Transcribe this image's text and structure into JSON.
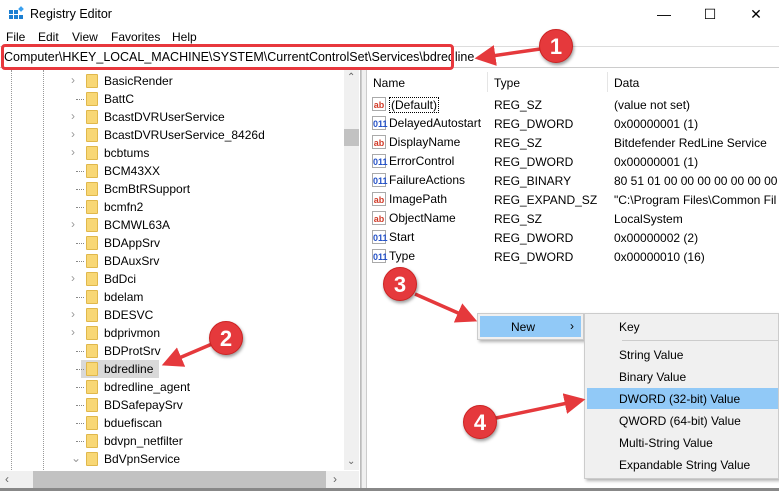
{
  "window": {
    "title": "Registry Editor",
    "controls": [
      "—",
      "☐",
      "✕"
    ]
  },
  "menu": [
    "File",
    "Edit",
    "View",
    "Favorites",
    "Help"
  ],
  "address": "Computer\\HKEY_LOCAL_MACHINE\\SYSTEM\\CurrentControlSet\\Services\\bdredline",
  "tree": {
    "items": [
      {
        "label": "BasicRender",
        "expander": "collapsed"
      },
      {
        "label": "BattC",
        "expander": "none"
      },
      {
        "label": "BcastDVRUserService",
        "expander": "collapsed"
      },
      {
        "label": "BcastDVRUserService_8426d",
        "expander": "collapsed"
      },
      {
        "label": "bcbtums",
        "expander": "collapsed"
      },
      {
        "label": "BCM43XX",
        "expander": "none"
      },
      {
        "label": "BcmBtRSupport",
        "expander": "none"
      },
      {
        "label": "bcmfn2",
        "expander": "none"
      },
      {
        "label": "BCMWL63A",
        "expander": "collapsed"
      },
      {
        "label": "BDAppSrv",
        "expander": "none"
      },
      {
        "label": "BDAuxSrv",
        "expander": "none"
      },
      {
        "label": "BdDci",
        "expander": "collapsed"
      },
      {
        "label": "bdelam",
        "expander": "none"
      },
      {
        "label": "BDESVC",
        "expander": "collapsed"
      },
      {
        "label": "bdprivmon",
        "expander": "collapsed"
      },
      {
        "label": "BDProtSrv",
        "expander": "none"
      },
      {
        "label": "bdredline",
        "expander": "none",
        "selected": true
      },
      {
        "label": "bdredline_agent",
        "expander": "none"
      },
      {
        "label": "BDSafepaySrv",
        "expander": "none"
      },
      {
        "label": "bduefiscan",
        "expander": "none"
      },
      {
        "label": "bdvpn_netfilter",
        "expander": "none"
      },
      {
        "label": "BdVpnService",
        "expander": "expanded"
      }
    ]
  },
  "list": {
    "columns": [
      "Name",
      "Type",
      "Data"
    ],
    "rows": [
      {
        "icon": "ab",
        "name": "(Default)",
        "type": "REG_SZ",
        "data": "(value not set)"
      },
      {
        "icon": "bin",
        "name": "DelayedAutostart",
        "type": "REG_DWORD",
        "data": "0x00000001 (1)"
      },
      {
        "icon": "ab",
        "name": "DisplayName",
        "type": "REG_SZ",
        "data": "Bitdefender RedLine Service"
      },
      {
        "icon": "bin",
        "name": "ErrorControl",
        "type": "REG_DWORD",
        "data": "0x00000001 (1)"
      },
      {
        "icon": "bin",
        "name": "FailureActions",
        "type": "REG_BINARY",
        "data": "80 51 01 00 00 00 00 00 00 00 00"
      },
      {
        "icon": "ab",
        "name": "ImagePath",
        "type": "REG_EXPAND_SZ",
        "data": "\"C:\\Program Files\\Common Fil"
      },
      {
        "icon": "ab",
        "name": "ObjectName",
        "type": "REG_SZ",
        "data": "LocalSystem"
      },
      {
        "icon": "bin",
        "name": "Start",
        "type": "REG_DWORD",
        "data": "0x00000002 (2)"
      },
      {
        "icon": "bin",
        "name": "Type",
        "type": "REG_DWORD",
        "data": "0x00000010 (16)"
      }
    ],
    "icon_text": {
      "ab": "ab",
      "bin": "011"
    }
  },
  "context_menu": {
    "new_label": "New",
    "arrow": "›",
    "submenu": [
      "Key",
      "String Value",
      "Binary Value",
      "DWORD (32-bit) Value",
      "QWORD (64-bit) Value",
      "Multi-String Value",
      "Expandable String Value"
    ],
    "highlighted": "DWORD (32-bit) Value"
  },
  "annotations": [
    "1",
    "2",
    "3",
    "4"
  ],
  "colors": {
    "highlight": "#91c9f7",
    "annotation": "#e5393c",
    "folder": "#f8d775"
  }
}
